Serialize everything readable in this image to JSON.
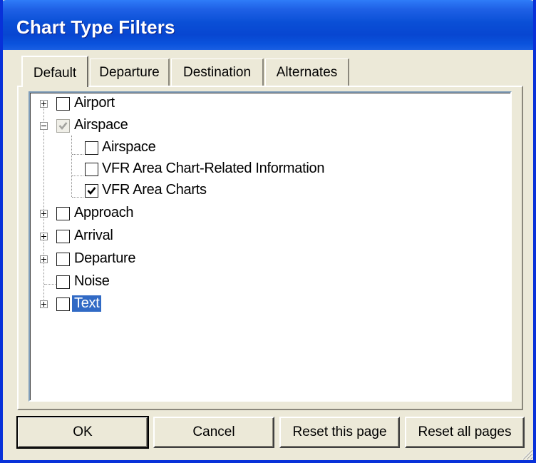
{
  "window": {
    "title": "Chart Type Filters"
  },
  "tabs": [
    {
      "label": "Default",
      "active": true
    },
    {
      "label": "Departure",
      "active": false
    },
    {
      "label": "Destination",
      "active": false
    },
    {
      "label": "Alternates",
      "active": false
    }
  ],
  "tree": {
    "items": [
      {
        "label": "Airport",
        "expander": "plus",
        "checked": false
      },
      {
        "label": "Airspace",
        "expander": "minus",
        "checked": "partial"
      },
      {
        "label": "Airspace",
        "checked": false
      },
      {
        "label": "VFR Area Chart-Related Information",
        "checked": false
      },
      {
        "label": "VFR Area Charts",
        "checked": true
      },
      {
        "label": "Approach",
        "expander": "plus",
        "checked": false
      },
      {
        "label": "Arrival",
        "expander": "plus",
        "checked": false
      },
      {
        "label": "Departure",
        "expander": "plus",
        "checked": false
      },
      {
        "label": "Noise",
        "checked": false
      },
      {
        "label": "Text",
        "expander": "plus",
        "checked": false,
        "selected": true
      }
    ]
  },
  "buttons": {
    "ok": "OK",
    "cancel": "Cancel",
    "reset_page": "Reset this page",
    "reset_all": "Reset all pages"
  }
}
